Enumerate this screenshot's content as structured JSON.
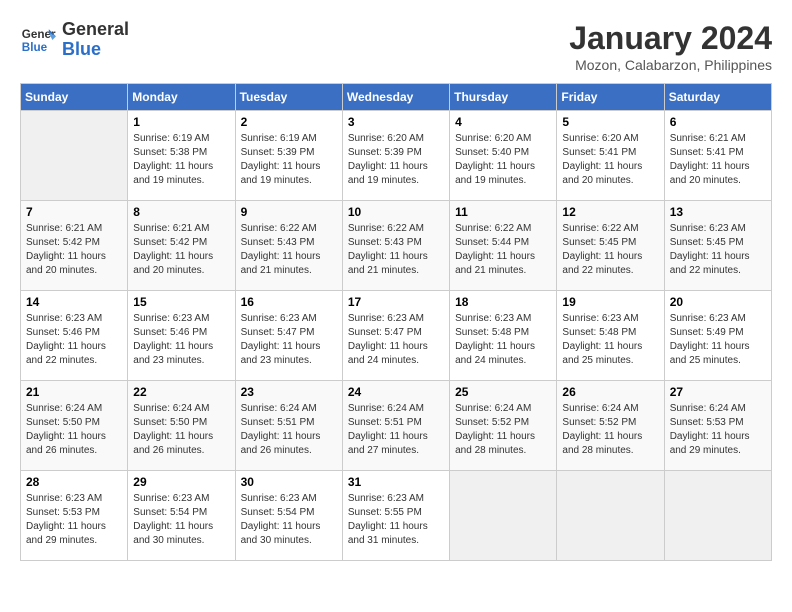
{
  "logo": {
    "line1": "General",
    "line2": "Blue"
  },
  "title": "January 2024",
  "subtitle": "Mozon, Calabarzon, Philippines",
  "days_header": [
    "Sunday",
    "Monday",
    "Tuesday",
    "Wednesday",
    "Thursday",
    "Friday",
    "Saturday"
  ],
  "weeks": [
    [
      {
        "num": "",
        "info": ""
      },
      {
        "num": "1",
        "info": "Sunrise: 6:19 AM\nSunset: 5:38 PM\nDaylight: 11 hours\nand 19 minutes."
      },
      {
        "num": "2",
        "info": "Sunrise: 6:19 AM\nSunset: 5:39 PM\nDaylight: 11 hours\nand 19 minutes."
      },
      {
        "num": "3",
        "info": "Sunrise: 6:20 AM\nSunset: 5:39 PM\nDaylight: 11 hours\nand 19 minutes."
      },
      {
        "num": "4",
        "info": "Sunrise: 6:20 AM\nSunset: 5:40 PM\nDaylight: 11 hours\nand 19 minutes."
      },
      {
        "num": "5",
        "info": "Sunrise: 6:20 AM\nSunset: 5:41 PM\nDaylight: 11 hours\nand 20 minutes."
      },
      {
        "num": "6",
        "info": "Sunrise: 6:21 AM\nSunset: 5:41 PM\nDaylight: 11 hours\nand 20 minutes."
      }
    ],
    [
      {
        "num": "7",
        "info": "Sunrise: 6:21 AM\nSunset: 5:42 PM\nDaylight: 11 hours\nand 20 minutes."
      },
      {
        "num": "8",
        "info": "Sunrise: 6:21 AM\nSunset: 5:42 PM\nDaylight: 11 hours\nand 20 minutes."
      },
      {
        "num": "9",
        "info": "Sunrise: 6:22 AM\nSunset: 5:43 PM\nDaylight: 11 hours\nand 21 minutes."
      },
      {
        "num": "10",
        "info": "Sunrise: 6:22 AM\nSunset: 5:43 PM\nDaylight: 11 hours\nand 21 minutes."
      },
      {
        "num": "11",
        "info": "Sunrise: 6:22 AM\nSunset: 5:44 PM\nDaylight: 11 hours\nand 21 minutes."
      },
      {
        "num": "12",
        "info": "Sunrise: 6:22 AM\nSunset: 5:45 PM\nDaylight: 11 hours\nand 22 minutes."
      },
      {
        "num": "13",
        "info": "Sunrise: 6:23 AM\nSunset: 5:45 PM\nDaylight: 11 hours\nand 22 minutes."
      }
    ],
    [
      {
        "num": "14",
        "info": "Sunrise: 6:23 AM\nSunset: 5:46 PM\nDaylight: 11 hours\nand 22 minutes."
      },
      {
        "num": "15",
        "info": "Sunrise: 6:23 AM\nSunset: 5:46 PM\nDaylight: 11 hours\nand 23 minutes."
      },
      {
        "num": "16",
        "info": "Sunrise: 6:23 AM\nSunset: 5:47 PM\nDaylight: 11 hours\nand 23 minutes."
      },
      {
        "num": "17",
        "info": "Sunrise: 6:23 AM\nSunset: 5:47 PM\nDaylight: 11 hours\nand 24 minutes."
      },
      {
        "num": "18",
        "info": "Sunrise: 6:23 AM\nSunset: 5:48 PM\nDaylight: 11 hours\nand 24 minutes."
      },
      {
        "num": "19",
        "info": "Sunrise: 6:23 AM\nSunset: 5:48 PM\nDaylight: 11 hours\nand 25 minutes."
      },
      {
        "num": "20",
        "info": "Sunrise: 6:23 AM\nSunset: 5:49 PM\nDaylight: 11 hours\nand 25 minutes."
      }
    ],
    [
      {
        "num": "21",
        "info": "Sunrise: 6:24 AM\nSunset: 5:50 PM\nDaylight: 11 hours\nand 26 minutes."
      },
      {
        "num": "22",
        "info": "Sunrise: 6:24 AM\nSunset: 5:50 PM\nDaylight: 11 hours\nand 26 minutes."
      },
      {
        "num": "23",
        "info": "Sunrise: 6:24 AM\nSunset: 5:51 PM\nDaylight: 11 hours\nand 26 minutes."
      },
      {
        "num": "24",
        "info": "Sunrise: 6:24 AM\nSunset: 5:51 PM\nDaylight: 11 hours\nand 27 minutes."
      },
      {
        "num": "25",
        "info": "Sunrise: 6:24 AM\nSunset: 5:52 PM\nDaylight: 11 hours\nand 28 minutes."
      },
      {
        "num": "26",
        "info": "Sunrise: 6:24 AM\nSunset: 5:52 PM\nDaylight: 11 hours\nand 28 minutes."
      },
      {
        "num": "27",
        "info": "Sunrise: 6:24 AM\nSunset: 5:53 PM\nDaylight: 11 hours\nand 29 minutes."
      }
    ],
    [
      {
        "num": "28",
        "info": "Sunrise: 6:23 AM\nSunset: 5:53 PM\nDaylight: 11 hours\nand 29 minutes."
      },
      {
        "num": "29",
        "info": "Sunrise: 6:23 AM\nSunset: 5:54 PM\nDaylight: 11 hours\nand 30 minutes."
      },
      {
        "num": "30",
        "info": "Sunrise: 6:23 AM\nSunset: 5:54 PM\nDaylight: 11 hours\nand 30 minutes."
      },
      {
        "num": "31",
        "info": "Sunrise: 6:23 AM\nSunset: 5:55 PM\nDaylight: 11 hours\nand 31 minutes."
      },
      {
        "num": "",
        "info": ""
      },
      {
        "num": "",
        "info": ""
      },
      {
        "num": "",
        "info": ""
      }
    ]
  ]
}
